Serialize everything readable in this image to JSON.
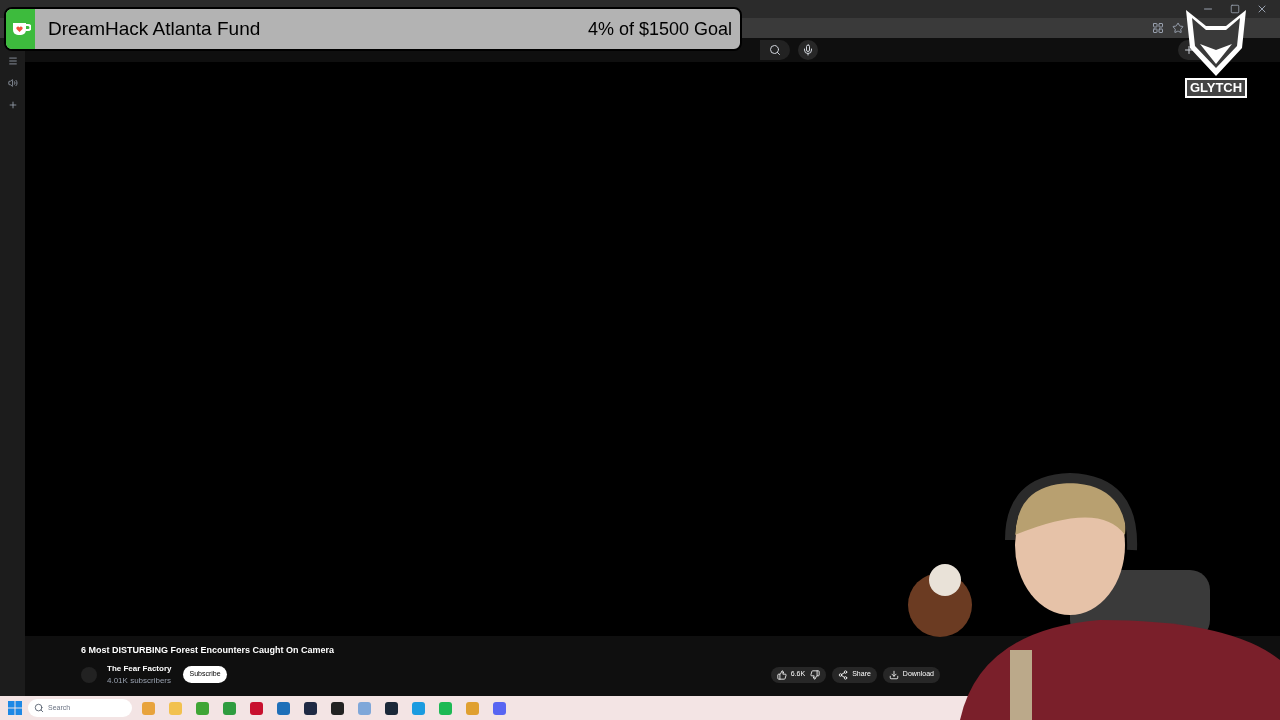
{
  "goal_overlay": {
    "title": "DreamHack Atlanta Fund",
    "progress": "4% of $1500 Goal",
    "level": 0.04
  },
  "logo": {
    "text": "GLYTCH"
  },
  "video": {
    "title": "6 Most DISTURBING Forest Encounters Caught On Camera",
    "channel": "The Fear Factory",
    "subscribers": "4.01K subscribers",
    "subscribe": "Subscribe",
    "likes": "6.6K",
    "share": "Share",
    "download": "Download"
  },
  "taskbar": {
    "search_placeholder": "Search",
    "apps": [
      {
        "color": "#e8a33c"
      },
      {
        "color": "#f2c14e"
      },
      {
        "color": "#3fa535"
      },
      {
        "color": "#2e9c3f"
      },
      {
        "color": "#c8102e"
      },
      {
        "color": "#1e6fb8"
      },
      {
        "color": "#1f2a44"
      },
      {
        "color": "#222222"
      },
      {
        "color": "#7fa7d9"
      },
      {
        "color": "#1b2838"
      },
      {
        "color": "#1a9be0"
      },
      {
        "color": "#1db954"
      },
      {
        "color": "#e0a030"
      },
      {
        "color": "#5865f2"
      }
    ]
  }
}
